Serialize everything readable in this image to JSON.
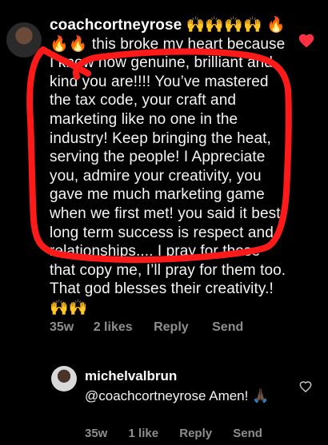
{
  "comment": {
    "username": "coachcortneyrose",
    "text": "🙌🙌🙌🙌 🔥🔥🔥 this broke my heart because I know how genuine, brilliant and kind you are!!!! You’ve mastered the tax code, your craft and marketing like no one in the industry! Keep bringing the heat, serving the people! I Appreciate you, admire your creativity, you gave me much marketing game when we first met! you said it best, long term success is respect and relationships.... I pray for those that copy me, I’ll pray for them too. That god blesses their creativity.! 🙌🙌",
    "time": "35w",
    "likes": "2 likes",
    "reply_label": "Reply",
    "send_label": "Send",
    "liked": true,
    "heart_color": "#ff3040"
  },
  "reply": {
    "username": "michelvalbrun",
    "text": "@coachcortneyrose Amen! 🙏🏿",
    "time": "35w",
    "likes": "1 like",
    "reply_label": "Reply",
    "send_label": "Send",
    "liked": false
  },
  "annotation_color": "#ff1a1a"
}
